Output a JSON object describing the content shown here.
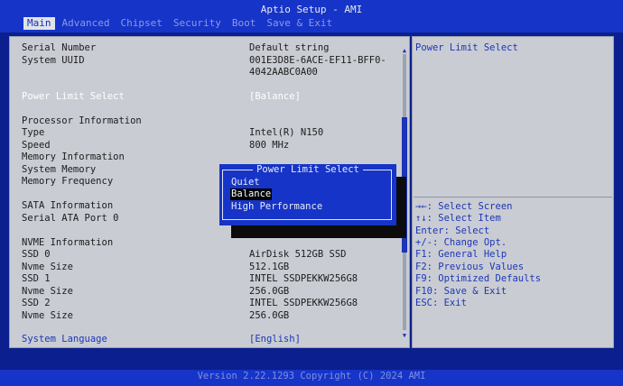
{
  "title": "Aptio Setup - AMI",
  "tabs": [
    "Main",
    "Advanced",
    "Chipset",
    "Security",
    "Boot",
    "Save & Exit"
  ],
  "main": {
    "serial_number": {
      "label": "Serial Number",
      "value": "Default string"
    },
    "system_uuid": {
      "label": "System UUID",
      "value_line1": "001E3D8E-6ACE-EF11-BFF0-",
      "value_line2": "4042AABC0A00"
    },
    "power_limit": {
      "label": "Power Limit Select",
      "value": "[Balance]"
    },
    "processor_header": "Processor Information",
    "type": {
      "label": "Type",
      "value": "Intel(R) N150"
    },
    "speed": {
      "label": "Speed",
      "value": "800 MHz"
    },
    "memory_header": "Memory Information",
    "system_memory": {
      "label": "System Memory"
    },
    "memory_frequency": {
      "label": "Memory Frequency"
    },
    "sata_header": "SATA Information",
    "sata_port0": {
      "label": "Serial ATA Port 0"
    },
    "nvme_header": "NVME Information",
    "ssd0": {
      "label": "SSD 0",
      "value": "AirDisk 512GB SSD"
    },
    "nvme_size0": {
      "label": "Nvme Size",
      "value": "512.1GB"
    },
    "ssd1": {
      "label": "SSD 1",
      "value": "INTEL SSDPEKKW256G8"
    },
    "nvme_size1": {
      "label": "Nvme Size",
      "value": "256.0GB"
    },
    "ssd2": {
      "label": "SSD 2",
      "value": "INTEL SSDPEKKW256G8"
    },
    "nvme_size2": {
      "label": "Nvme Size",
      "value": "256.0GB"
    },
    "system_language": {
      "label": "System Language",
      "value": "[English]"
    }
  },
  "help": {
    "description": "Power Limit Select",
    "keys": [
      "→←: Select Screen",
      "↑↓: Select Item",
      "Enter: Select",
      "+/-: Change Opt.",
      "F1: General Help",
      "F2: Previous Values",
      "F9: Optimized Defaults",
      "F10: Save & Exit",
      "ESC: Exit"
    ]
  },
  "popup": {
    "title": "Power Limit Select",
    "options": [
      "Quiet",
      "Balance",
      "High Performance"
    ],
    "selected": "Balance"
  },
  "footer": "Version 2.22.1293 Copyright (C) 2024 AMI",
  "colors": {
    "background": "#0b1f8e",
    "panel": "#c9ccd3",
    "accent": "#1634c8"
  }
}
